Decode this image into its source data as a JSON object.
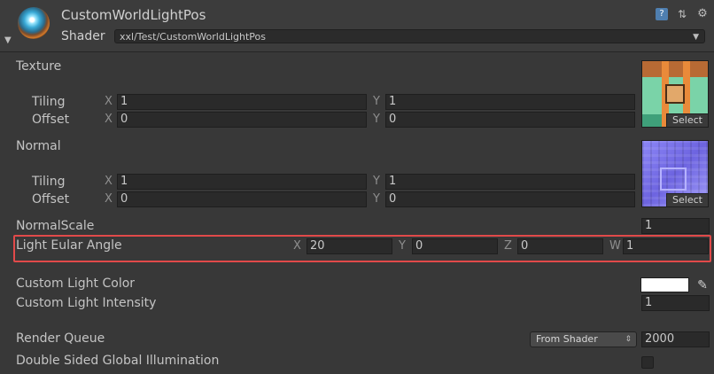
{
  "header": {
    "title": "CustomWorldLightPos",
    "shader_label": "Shader",
    "shader_value": "xxl/Test/CustomWorldLightPos",
    "icons": [
      "material-sphere-icon",
      "help-icon",
      "preset-icon",
      "gear-icon",
      "fold-triangle-icon"
    ]
  },
  "texture": {
    "label": "Texture",
    "tiling_label": "Tiling",
    "offset_label": "Offset",
    "tiling_x": "1",
    "tiling_y": "1",
    "offset_x": "0",
    "offset_y": "0",
    "select_label": "Select"
  },
  "normal": {
    "label": "Normal",
    "tiling_label": "Tiling",
    "offset_label": "Offset",
    "tiling_x": "1",
    "tiling_y": "1",
    "offset_x": "0",
    "offset_y": "0",
    "select_label": "Select"
  },
  "axes": {
    "x": "X",
    "y": "Y",
    "z": "Z",
    "w": "W"
  },
  "normal_scale": {
    "label": "NormalScale",
    "value": "1"
  },
  "light_euler": {
    "label": "Light Eular Angle",
    "x": "20",
    "y": "0",
    "z": "0",
    "w": "1"
  },
  "custom_light_color": {
    "label": "Custom Light Color",
    "color": "#ffffff"
  },
  "custom_light_intensity": {
    "label": "Custom Light Intensity",
    "value": "1"
  },
  "render_queue": {
    "label": "Render Queue",
    "mode": "From Shader",
    "value": "2000"
  },
  "double_sided_gi": {
    "label": "Double Sided Global Illumination",
    "checked": false
  },
  "colors": {
    "highlight": "#e14a4a",
    "background": "#383838",
    "field": "#2a2a2a"
  }
}
